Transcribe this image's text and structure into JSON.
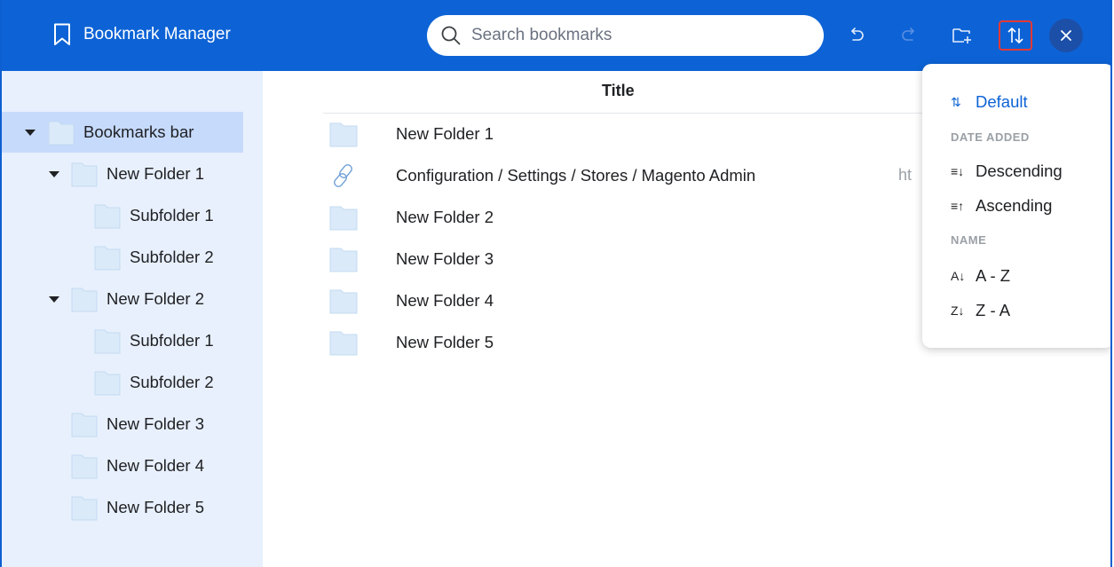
{
  "header": {
    "app_title": "Bookmark Manager",
    "search_placeholder": "Search bookmarks",
    "brand_color": "#0d63d6"
  },
  "sidebar": {
    "items": [
      {
        "label": "Bookmarks bar",
        "level": 0,
        "expanded": true,
        "selected": true
      },
      {
        "label": "New Folder 1",
        "level": 1,
        "expanded": true
      },
      {
        "label": "Subfolder 1",
        "level": 2
      },
      {
        "label": "Subfolder 2",
        "level": 2
      },
      {
        "label": "New Folder 2",
        "level": 1,
        "expanded": true
      },
      {
        "label": "Subfolder 1",
        "level": 2
      },
      {
        "label": "Subfolder 2",
        "level": 2
      },
      {
        "label": "New Folder 3",
        "level": 1
      },
      {
        "label": "New Folder 4",
        "level": 1
      },
      {
        "label": "New Folder 5",
        "level": 1
      }
    ]
  },
  "main": {
    "column_title": "Title",
    "rows": [
      {
        "label": "New Folder 1",
        "type": "folder"
      },
      {
        "label": "Configuration / Settings / Stores / Magento Admin",
        "type": "link",
        "url_fragment": "ht"
      },
      {
        "label": "New Folder 2",
        "type": "folder"
      },
      {
        "label": "New Folder 3",
        "type": "folder"
      },
      {
        "label": "New Folder 4",
        "type": "folder"
      },
      {
        "label": "New Folder 5",
        "type": "folder"
      }
    ]
  },
  "sort_menu": {
    "default": {
      "glyph": "⇅",
      "label": "Default"
    },
    "date_section": "DATE ADDED",
    "descending": {
      "glyph": "≡↓",
      "label": "Descending"
    },
    "ascending": {
      "glyph": "≡↑",
      "label": "Ascending"
    },
    "name_section": "NAME",
    "az": {
      "glyph": "A↓",
      "label": "A - Z"
    },
    "za": {
      "glyph": "Z↓",
      "label": "Z - A"
    }
  }
}
